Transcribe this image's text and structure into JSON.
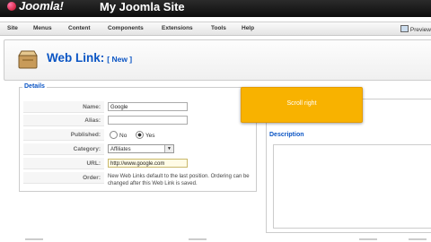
{
  "header": {
    "logo_text": "Joomla!",
    "site_title": "My Joomla Site"
  },
  "menubar": {
    "items": [
      "Site",
      "Menus",
      "Content",
      "Components",
      "Extensions",
      "Tools",
      "Help"
    ],
    "preview_label": "Preview"
  },
  "toolbar": {
    "title": "Web Link:",
    "subtitle": "[ New ]"
  },
  "details": {
    "legend": "Details",
    "name_label": "Name:",
    "name_value": "Google",
    "alias_label": "Alias:",
    "alias_value": "",
    "published_label": "Published:",
    "published_no": "No",
    "published_yes": "Yes",
    "published_value": "Yes",
    "category_label": "Category:",
    "category_value": "Affiliates",
    "url_label": "URL:",
    "url_value": "http://www.google.com",
    "order_label": "Order:",
    "order_text": "New Web Links default to the last position. Ordering can be changed after this Web Link is saved."
  },
  "parameters": {
    "description_legend": "Description"
  },
  "tooltip": {
    "text": "Scroll right"
  },
  "colors": {
    "accent": "#0b55c4",
    "tooltip_bg": "#f8b200",
    "header_bg": "#111111"
  }
}
